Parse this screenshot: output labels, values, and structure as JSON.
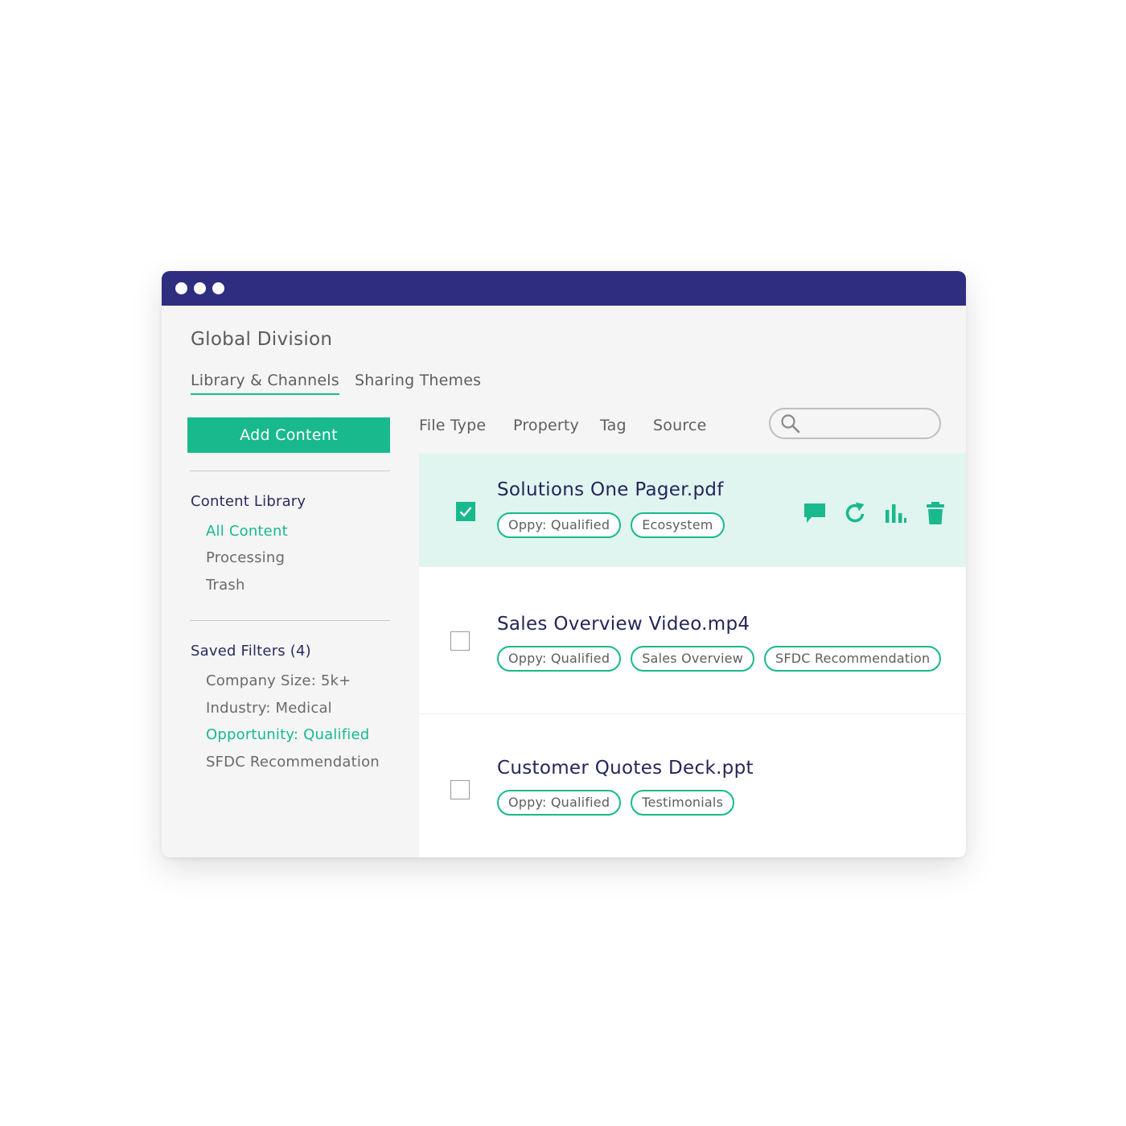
{
  "app": {
    "division": "Global Division",
    "tabs": [
      {
        "label": "Library & Channels",
        "active": true
      },
      {
        "label": "Sharing Themes",
        "active": false
      }
    ]
  },
  "sidebar": {
    "add_button": "Add Content",
    "content_library": {
      "title": "Content Library",
      "items": [
        {
          "label": "All Content",
          "active": true
        },
        {
          "label": "Processing",
          "active": false
        },
        {
          "label": "Trash",
          "active": false
        }
      ]
    },
    "saved_filters": {
      "title": "Saved Filters (4)",
      "items": [
        {
          "label": "Company Size: 5k+",
          "active": false
        },
        {
          "label": "Industry: Medical",
          "active": false
        },
        {
          "label": "Opportunity: Qualified",
          "active": true
        },
        {
          "label": "SFDC Recommendation",
          "active": false
        }
      ]
    }
  },
  "filters": {
    "labels": [
      "File Type",
      "Property",
      "Tag",
      "Source"
    ],
    "search_value": ""
  },
  "content": {
    "rows": [
      {
        "name": "Solutions One Pager.pdf",
        "checked": true,
        "tags": [
          "Oppy: Qualified",
          "Ecosystem"
        ]
      },
      {
        "name": "Sales Overview Video.mp4",
        "checked": false,
        "tags": [
          "Oppy: Qualified",
          "Sales Overview",
          "SFDC Recommendation"
        ]
      },
      {
        "name": "Customer Quotes Deck.ppt",
        "checked": false,
        "tags": [
          "Oppy: Qualified",
          "Testimonials"
        ]
      }
    ],
    "row_actions": [
      "comment-icon",
      "refresh-icon",
      "bar-chart-icon",
      "trash-icon"
    ]
  },
  "colors": {
    "titlebar": "#2e2d80",
    "accent": "#18b98d",
    "selected_row": "#e0f5ef",
    "heading_text": "#25255a"
  }
}
